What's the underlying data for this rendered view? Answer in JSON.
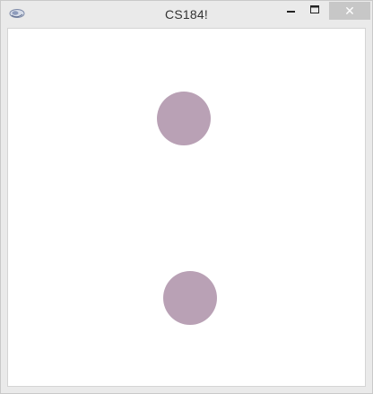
{
  "window": {
    "title": "CS184!",
    "app_icon": "app-logo-icon",
    "controls": {
      "minimize_icon": "minimize-icon",
      "maximize_icon": "maximize-icon",
      "close_icon": "close-icon",
      "close_glyph": "✕"
    }
  },
  "canvas": {
    "background_color": "#ffffff",
    "circle_color": "#b9a1b5"
  }
}
